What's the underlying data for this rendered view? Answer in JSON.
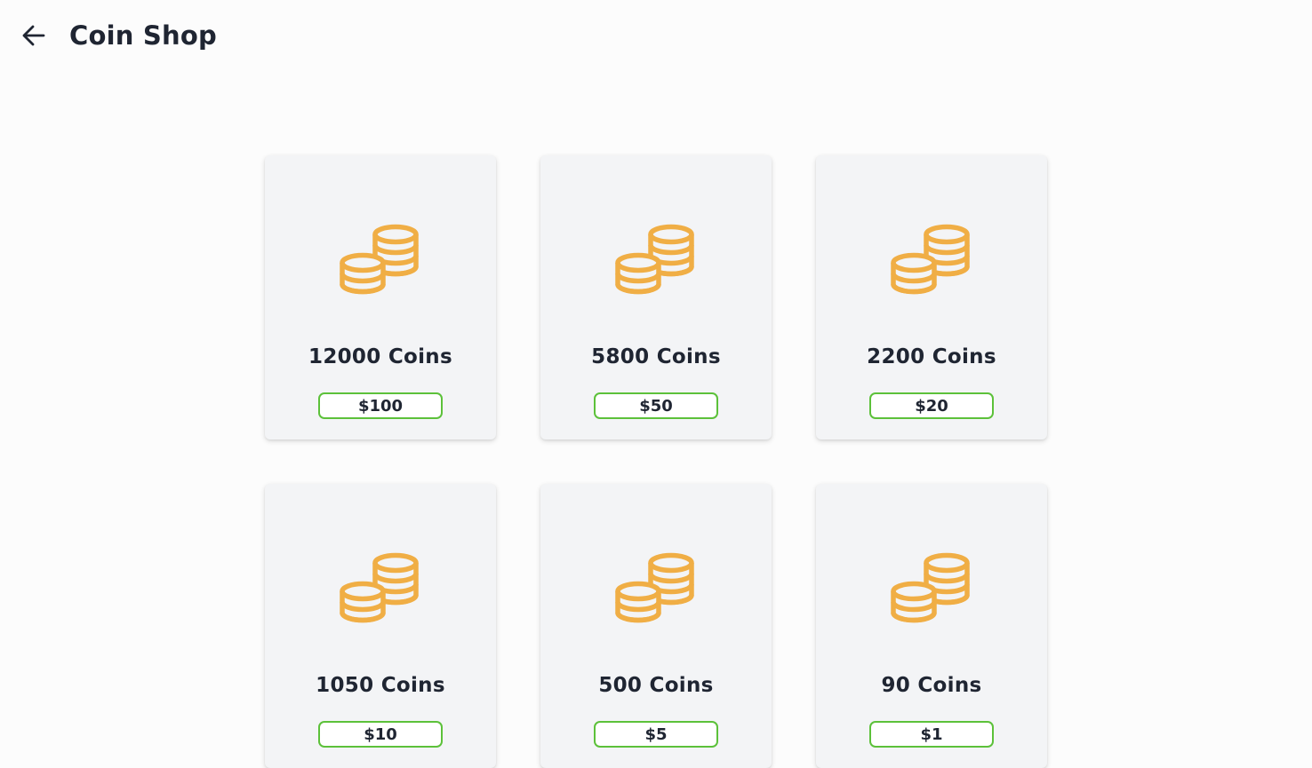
{
  "header": {
    "title": "Coin Shop",
    "back_icon": "arrow-left-icon"
  },
  "colors": {
    "coin": "#f0ae45",
    "price_border": "#5cc13a",
    "card_bg": "#f3f4f6",
    "page_bg": "#fcfcfc"
  },
  "packs": [
    {
      "coins_label": "12000 Coins",
      "price": "$100",
      "icon": "coins-stack-icon"
    },
    {
      "coins_label": "5800 Coins",
      "price": "$50",
      "icon": "coins-stack-icon"
    },
    {
      "coins_label": "2200 Coins",
      "price": "$20",
      "icon": "coins-stack-icon"
    },
    {
      "coins_label": "1050 Coins",
      "price": "$10",
      "icon": "coins-stack-icon"
    },
    {
      "coins_label": "500 Coins",
      "price": "$5",
      "icon": "coins-stack-icon"
    },
    {
      "coins_label": "90 Coins",
      "price": "$1",
      "icon": "coins-stack-icon"
    }
  ]
}
